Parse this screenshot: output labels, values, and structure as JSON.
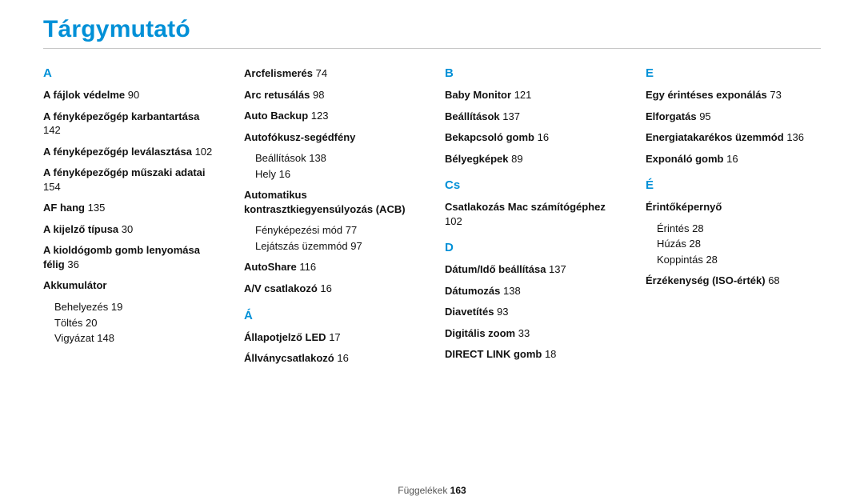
{
  "title": "Tárgymutató",
  "footer": {
    "label": "Függelékek",
    "page": "163"
  },
  "col1": {
    "letterA": "A",
    "e0": {
      "label": "A fájlok védelme",
      "page": "90"
    },
    "e1": {
      "label": "A fényképezőgép karbantartása",
      "page": "142"
    },
    "e2": {
      "label": "A fényképezőgép leválasztása",
      "page": "102"
    },
    "e3": {
      "label": "A fényképezőgép műszaki adatai",
      "page": "154"
    },
    "e4": {
      "label": "AF hang",
      "page": "135"
    },
    "e5": {
      "label": "A kijelző típusa",
      "page": "30"
    },
    "e6": {
      "label": "A kioldógomb gomb lenyomása félig",
      "page": "36"
    },
    "e7": {
      "label": "Akkumulátor"
    },
    "e7a": {
      "label": "Behelyezés",
      "page": "19"
    },
    "e7b": {
      "label": "Töltés",
      "page": "20"
    },
    "e7c": {
      "label": "Vigyázat",
      "page": "148"
    }
  },
  "col2": {
    "e0": {
      "label": "Arcfelismerés",
      "page": "74"
    },
    "e1": {
      "label": "Arc retusálás",
      "page": "98"
    },
    "e2": {
      "label": "Auto Backup",
      "page": "123"
    },
    "e3": {
      "label": "Autofókusz-segédfény"
    },
    "e3a": {
      "label": "Beállítások",
      "page": "138"
    },
    "e3b": {
      "label": "Hely",
      "page": "16"
    },
    "e4": {
      "label": "Automatikus kontrasztkiegyensúlyozás (ACB)"
    },
    "e4a": {
      "label": "Fényképezési mód",
      "page": "77"
    },
    "e4b": {
      "label": "Lejátszás üzemmód",
      "page": "97"
    },
    "e5": {
      "label": "AutoShare",
      "page": "116"
    },
    "e6": {
      "label": "A/V csatlakozó",
      "page": "16"
    },
    "letterA2": "Á",
    "e7": {
      "label": "Állapotjelző LED",
      "page": "17"
    },
    "e8": {
      "label": "Állványcsatlakozó",
      "page": "16"
    }
  },
  "col3": {
    "letterB": "B",
    "e0": {
      "label": "Baby Monitor",
      "page": "121"
    },
    "e1": {
      "label": "Beállítások",
      "page": "137"
    },
    "e2": {
      "label": "Bekapcsoló gomb",
      "page": "16"
    },
    "e3": {
      "label": "Bélyegképek",
      "page": "89"
    },
    "letterCs": "Cs",
    "e4": {
      "label": "Csatlakozás Mac számítógéphez",
      "page": "102"
    },
    "letterD": "D",
    "e5": {
      "label": "Dátum/Idő beállítása",
      "page": "137"
    },
    "e6": {
      "label": "Dátumozás",
      "page": "138"
    },
    "e7": {
      "label": "Diavetítés",
      "page": "93"
    },
    "e8": {
      "label": "Digitális zoom",
      "page": "33"
    },
    "e9": {
      "label": "DIRECT LINK gomb",
      "page": "18"
    }
  },
  "col4": {
    "letterE": "E",
    "e0": {
      "label": "Egy érintéses exponálás",
      "page": "73"
    },
    "e1": {
      "label": "Elforgatás",
      "page": "95"
    },
    "e2": {
      "label": "Energiatakarékos üzemmód",
      "page": "136"
    },
    "e3": {
      "label": "Exponáló gomb",
      "page": "16"
    },
    "letterE2": "É",
    "e4": {
      "label": "Érintőképernyő"
    },
    "e4a": {
      "label": "Érintés",
      "page": "28"
    },
    "e4b": {
      "label": "Húzás",
      "page": "28"
    },
    "e4c": {
      "label": "Koppintás",
      "page": "28"
    },
    "e5": {
      "label": "Érzékenység (ISO-érték)",
      "page": "68"
    }
  }
}
